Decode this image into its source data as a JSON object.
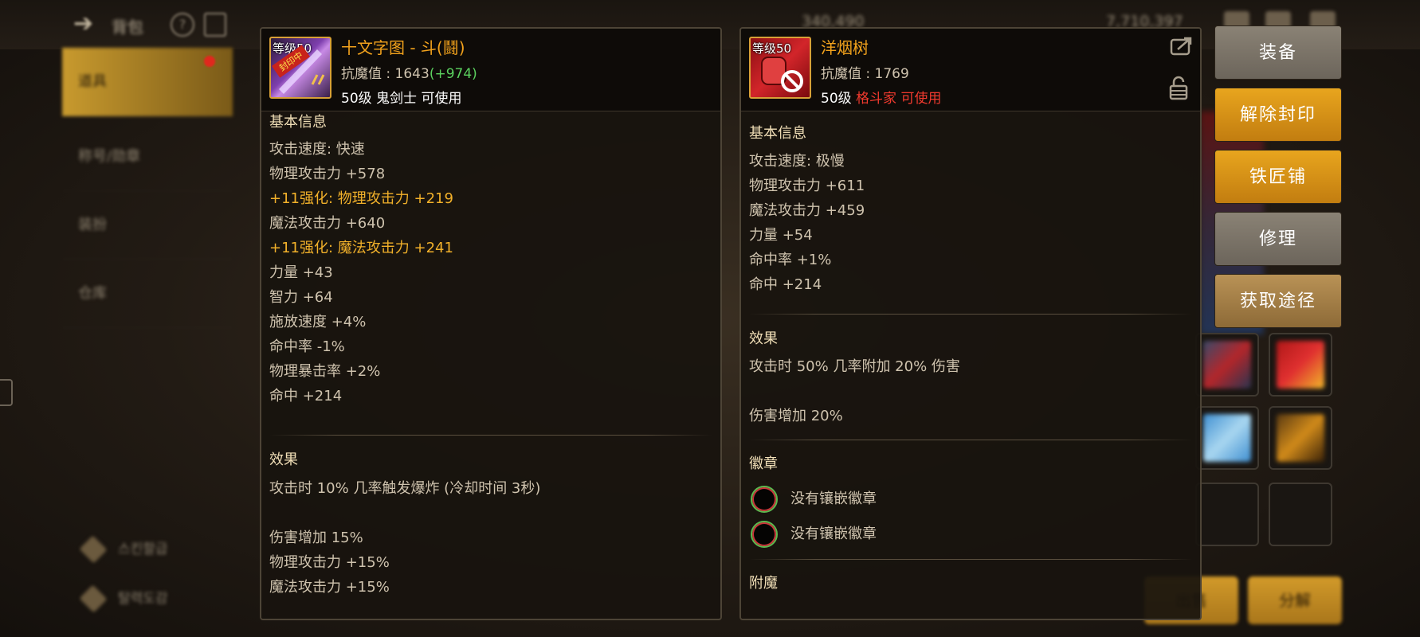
{
  "background": {
    "title": "背包",
    "currency": [
      "340,490",
      "7,710,397"
    ],
    "sidebar_items": [
      "道具",
      "称号/勋章",
      "装扮",
      "仓库"
    ],
    "sidebar_bottom": [
      "스킨할급",
      "탈력도감"
    ]
  },
  "left_item": {
    "icon_level": "等级50",
    "sealed_tag": "封印中",
    "name": "十文字图 - 斗(鬪)",
    "resist_label": "抗魔值 : 1643",
    "resist_bonus": "(+974)",
    "req_level": "50级",
    "req_class": "鬼剑士 可使用",
    "basic_title": "基本信息",
    "stats": [
      {
        "text": "攻击速度:  快速",
        "style": "normal"
      },
      {
        "text": "物理攻击力 +578",
        "style": "normal"
      },
      {
        "text": "+11强化:  物理攻击力 +219",
        "style": "gold"
      },
      {
        "text": "魔法攻击力 +640",
        "style": "normal"
      },
      {
        "text": "+11强化:  魔法攻击力 +241",
        "style": "gold"
      },
      {
        "text": "力量 +43",
        "style": "normal"
      },
      {
        "text": "智力 +64",
        "style": "normal"
      },
      {
        "text": "施放速度 +4%",
        "style": "normal"
      },
      {
        "text": "命中率 -1%",
        "style": "normal"
      },
      {
        "text": "物理暴击率 +2%",
        "style": "normal"
      },
      {
        "text": "命中 +214",
        "style": "normal"
      }
    ],
    "effect_title": "效果",
    "effects": [
      "攻击时 10% 几率触发爆炸 (冷却时间 3秒)",
      "伤害增加 15%",
      "物理攻击力 +15%",
      "魔法攻击力 +15%"
    ]
  },
  "right_item": {
    "icon_level": "等级50",
    "name": "洋烟树",
    "resist_label": "抗魔值 : 1769",
    "req_level": "50级",
    "req_class": "格斗家 可使用",
    "basic_title": "基本信息",
    "stats": [
      "攻击速度:  极慢",
      "物理攻击力 +611",
      "魔法攻击力 +459",
      "力量 +54",
      "命中率 +1%",
      "命中 +214"
    ],
    "effect_title": "效果",
    "effects": [
      "攻击时 50% 几率附加 20% 伤害",
      "伤害增加 20%"
    ],
    "emblem_title": "徽章",
    "emblems": [
      "没有镶嵌徽章",
      "没有镶嵌徽章"
    ],
    "enchant_title": "附魔"
  },
  "actions": [
    "装备",
    "解除封印",
    "铁匠铺",
    "修理",
    "获取途径"
  ],
  "bottom_buttons": [
    "出售",
    "分解"
  ],
  "colors": {
    "item_name": "#f2a21c",
    "bonus_green": "#5bd15f",
    "enhance_gold": "#f2b12a",
    "cannot_use_red": "#f03a2e",
    "button_gold": "#e8a51e",
    "button_gray": "#8a8275",
    "button_tan": "#b99256"
  }
}
